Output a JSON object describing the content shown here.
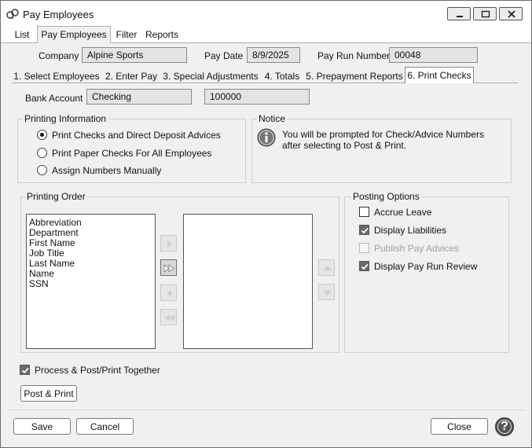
{
  "window": {
    "title": "Pay Employees"
  },
  "menu_tabs": [
    "List",
    "Pay Employees",
    "Filter",
    "Reports"
  ],
  "header": {
    "company_label": "Company",
    "company_value": "Alpine Sports",
    "pay_date_label": "Pay Date",
    "pay_date_value": "8/9/2025",
    "pay_run_label": "Pay Run Number",
    "pay_run_value": "00048"
  },
  "step_tabs": [
    "1. Select Employees",
    "2. Enter Pay",
    "3. Special Adjustments",
    "4. Totals",
    "5. Prepayment Reports",
    "6. Print Checks"
  ],
  "bank": {
    "label": "Bank Account",
    "value": "Checking",
    "number": "100000"
  },
  "printing_info": {
    "title": "Printing Information",
    "options": [
      "Print Checks and Direct Deposit Advices",
      "Print Paper Checks For All Employees",
      "Assign Numbers Manually"
    ],
    "selected": "Print Checks and Direct Deposit Advices"
  },
  "notice": {
    "title": "Notice",
    "line1": "You will be prompted for Check/Advice Numbers",
    "line2": "after selecting to Post & Print."
  },
  "printing_order": {
    "title": "Printing Order",
    "available": [
      "Abbreviation",
      "Department",
      "First Name",
      "Job Title",
      "Last Name",
      "Name",
      "SSN"
    ],
    "selected": []
  },
  "posting_options": {
    "title": "Posting Options",
    "accrue_leave": {
      "label": "Accrue Leave",
      "checked": false
    },
    "display_liabilities": {
      "label": "Display Liabilities",
      "checked": true
    },
    "publish_pay_advices": {
      "label": "Publish Pay Advices",
      "checked": false,
      "enabled": false
    },
    "display_pay_run_review": {
      "label": "Display Pay Run Review",
      "checked": true
    }
  },
  "process_together": {
    "label": "Process & Post/Print Together",
    "checked": true
  },
  "buttons": {
    "post_print": "Post & Print",
    "save": "Save",
    "cancel": "Cancel",
    "close": "Close",
    "help": "?"
  }
}
